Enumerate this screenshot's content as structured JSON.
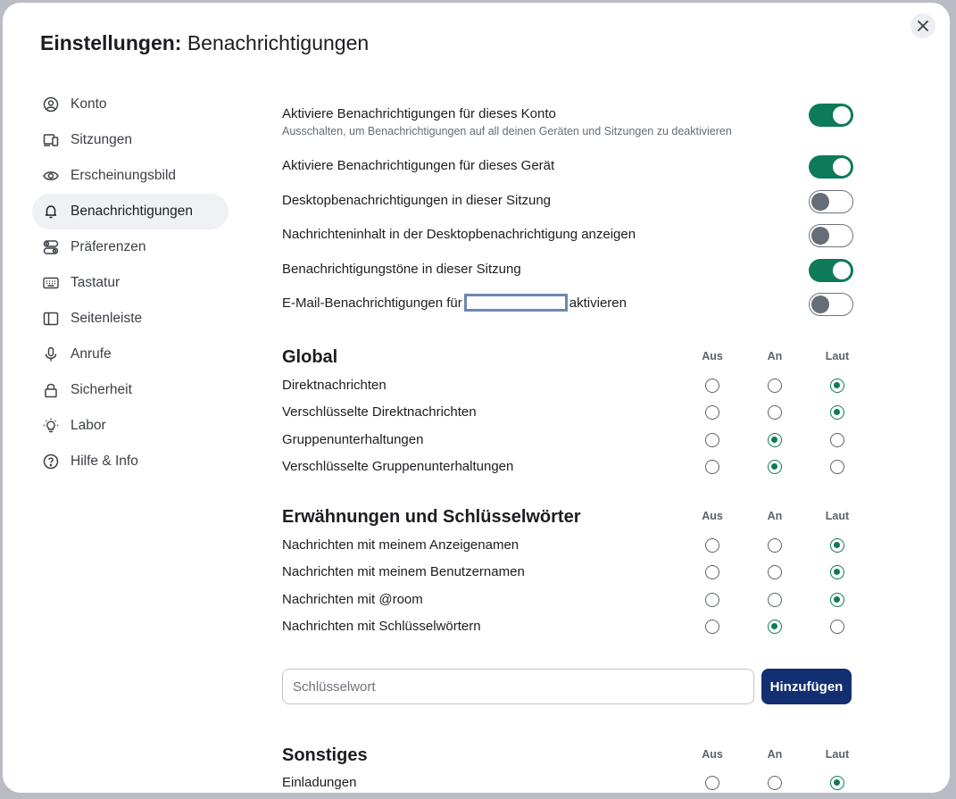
{
  "dialog": {
    "title_prefix": "Einstellungen:",
    "title_section": "Benachrichtigungen"
  },
  "sidebar": {
    "items": [
      {
        "label": "Konto",
        "icon": "user-circle-icon"
      },
      {
        "label": "Sitzungen",
        "icon": "devices-icon"
      },
      {
        "label": "Erscheinungsbild",
        "icon": "eye-icon"
      },
      {
        "label": "Benachrichtigungen",
        "icon": "bell-icon",
        "active": true
      },
      {
        "label": "Präferenzen",
        "icon": "preferences-icon"
      },
      {
        "label": "Tastatur",
        "icon": "keyboard-icon"
      },
      {
        "label": "Seitenleiste",
        "icon": "sidebar-icon"
      },
      {
        "label": "Anrufe",
        "icon": "microphone-icon"
      },
      {
        "label": "Sicherheit",
        "icon": "lock-icon"
      },
      {
        "label": "Labor",
        "icon": "lightbulb-icon"
      },
      {
        "label": "Hilfe & Info",
        "icon": "help-icon"
      }
    ]
  },
  "toggles": [
    {
      "label": "Aktiviere Benachrichtigungen für dieses Konto",
      "sub": "Ausschalten, um Benachrichtigungen auf all deinen Geräten und Sitzungen zu deaktivieren",
      "on": true
    },
    {
      "label": "Aktiviere Benachrichtigungen für dieses Gerät",
      "on": true
    },
    {
      "label": "Desktopbenachrichtigungen in dieser Sitzung",
      "on": false
    },
    {
      "label": "Nachrichteninhalt in der Desktopbenachrichtigung anzeigen",
      "on": false
    },
    {
      "label": "Benachrichtigungstöne in dieser Sitzung",
      "on": true
    },
    {
      "label_before": "E-Mail-Benachrichtigungen für",
      "label_after": "aktivieren",
      "on": false
    }
  ],
  "columns": [
    "Aus",
    "An",
    "Laut"
  ],
  "sections": [
    {
      "title": "Global",
      "rows": [
        {
          "label": "Direktnachrichten",
          "selected": "Laut"
        },
        {
          "label": "Verschlüsselte Direktnachrichten",
          "selected": "Laut"
        },
        {
          "label": "Gruppenunterhaltungen",
          "selected": "An"
        },
        {
          "label": "Verschlüsselte Gruppenunterhaltungen",
          "selected": "An"
        }
      ]
    },
    {
      "title": "Erwähnungen und Schlüsselwörter",
      "rows": [
        {
          "label": "Nachrichten mit meinem Anzeigenamen",
          "selected": "Laut"
        },
        {
          "label": "Nachrichten mit meinem Benutzernamen",
          "selected": "Laut"
        },
        {
          "label": "Nachrichten mit @room",
          "selected": "Laut"
        },
        {
          "label": "Nachrichten mit Schlüsselwörtern",
          "selected": "An"
        }
      ]
    },
    {
      "title": "Sonstiges",
      "rows": [
        {
          "label": "Einladungen",
          "selected": "Laut"
        }
      ]
    }
  ],
  "keyword": {
    "placeholder": "Schlüsselwort",
    "value": "",
    "add_label": "Hinzufügen"
  },
  "colors": {
    "accent": "#0e7a5a",
    "primary_button": "#122f72"
  }
}
